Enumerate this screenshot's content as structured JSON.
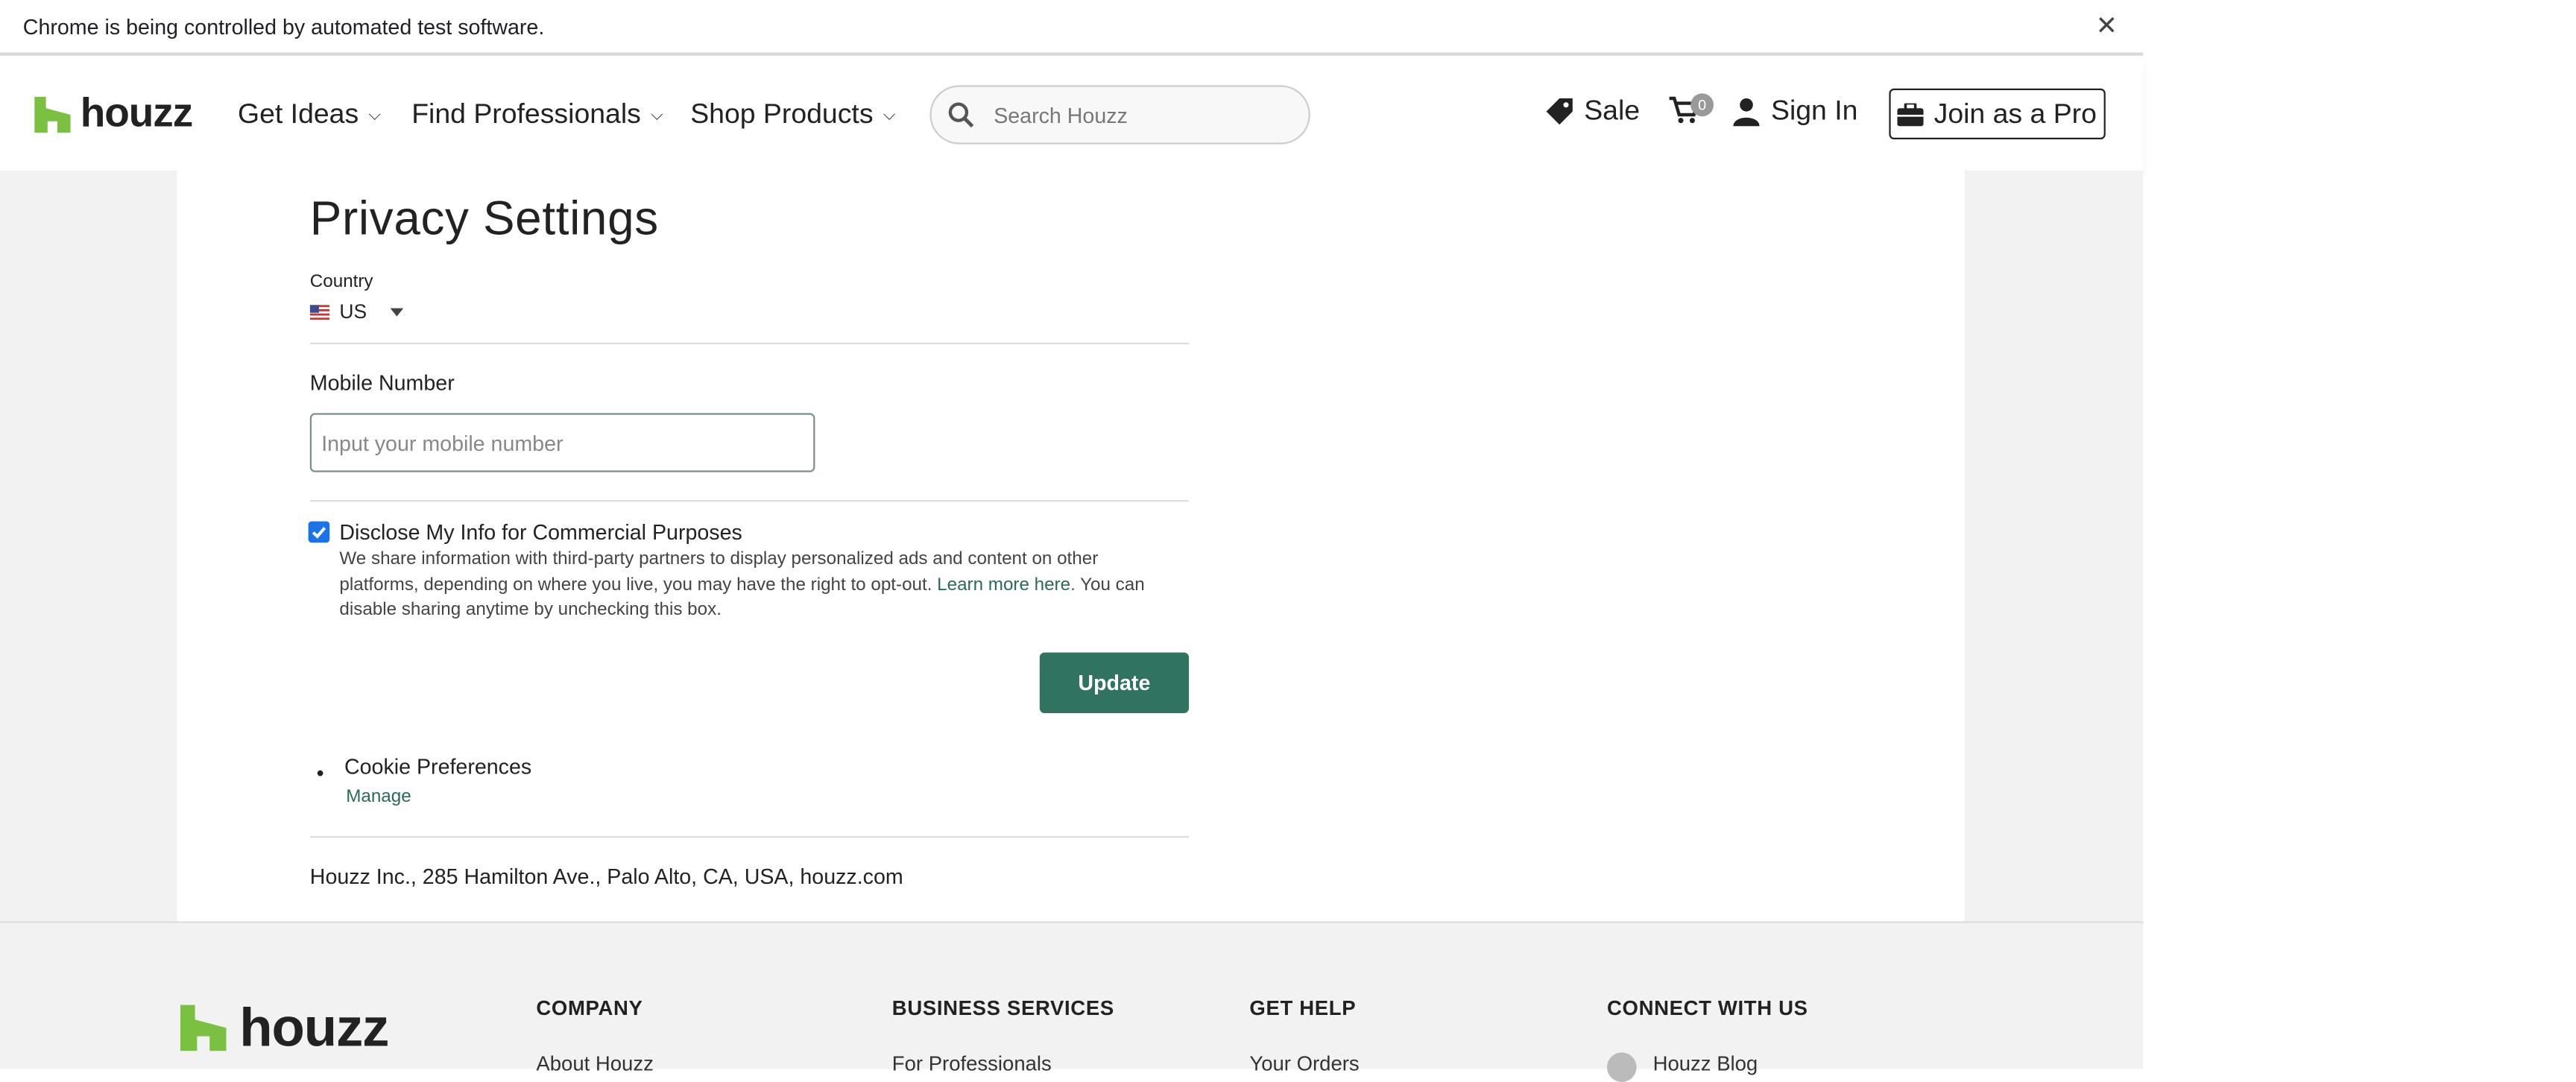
{
  "infobar": {
    "text": "Chrome is being controlled by automated test software.",
    "close_glyph": "✕"
  },
  "header": {
    "logo_text": "houzz",
    "nav": [
      {
        "label": "Get Ideas"
      },
      {
        "label": "Find Professionals"
      },
      {
        "label": "Shop Products"
      }
    ],
    "search_placeholder": "Search Houzz",
    "sale_label": "Sale",
    "cart_count": "0",
    "sign_in_label": "Sign In",
    "join_label": "Join as a Pro"
  },
  "main": {
    "title": "Privacy Settings",
    "country_label": "Country",
    "country_value": "US",
    "mobile_label": "Mobile Number",
    "mobile_placeholder": "Input your mobile number",
    "disclose_label": "Disclose My Info for Commercial Purposes",
    "disclose_checked": true,
    "disclose_desc_before": "We share information with third-party partners to display personalized ads and content on other platforms, depending on where you live, you may have the right to opt-out. ",
    "learn_more": "Learn more here.",
    "disclose_desc_after": " You can disable sharing anytime by unchecking this box.",
    "update_label": "Update",
    "cookie_label": "Cookie Preferences",
    "manage_label": "Manage",
    "address": "Houzz Inc., 285 Hamilton Ave., Palo Alto, CA, USA, houzz.com"
  },
  "footer": {
    "logo_text": "houzz",
    "columns": [
      {
        "title": "COMPANY",
        "first_link": "About Houzz"
      },
      {
        "title": "BUSINESS SERVICES",
        "first_link": "For Professionals"
      },
      {
        "title": "GET HELP",
        "first_link": "Your Orders"
      },
      {
        "title": "CONNECT WITH US",
        "first_link": "Houzz Blog"
      }
    ]
  },
  "colors": {
    "brand_green": "#7ac142",
    "button_green": "#2f7360",
    "link_green": "#2b6a5b",
    "checkbox_blue": "#1a73e8"
  }
}
